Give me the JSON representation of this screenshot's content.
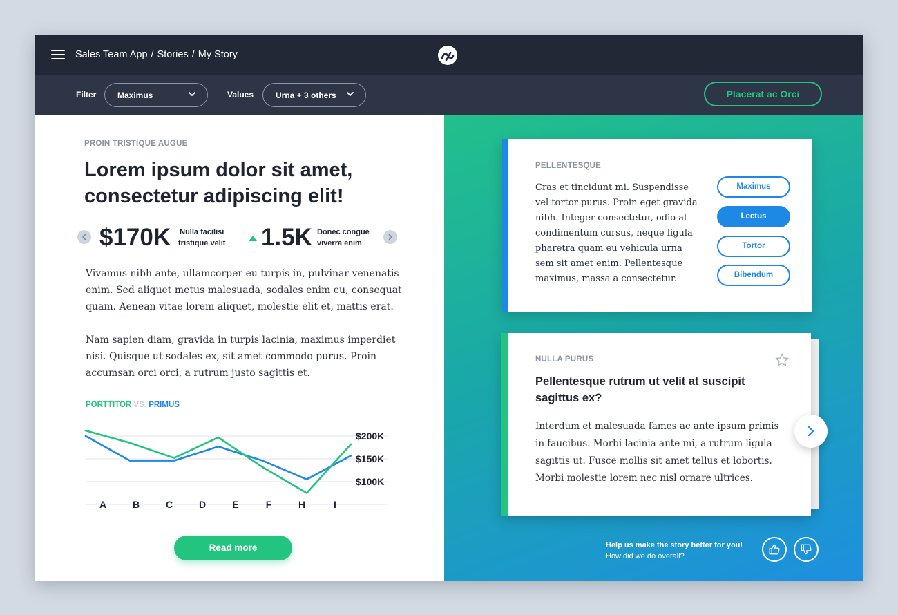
{
  "header": {
    "breadcrumb": [
      "Sales Team App",
      "Stories",
      "My Story"
    ],
    "breadcrumb_sep": "/"
  },
  "filterbar": {
    "filter_label": "Filter",
    "filter_value": "Maximus",
    "values_label": "Values",
    "values_value": "Urna + 3 others",
    "cta_label": "Placerat ac Orci"
  },
  "story": {
    "eyebrow": "PROIN TRISTIQUE AUGUE",
    "headline": "Lorem ipsum dolor sit amet, consectetur adipiscing elit!",
    "kpi1": {
      "value": "$170K",
      "desc_line1": "Nulla facilisi",
      "desc_line2": "tristique velit"
    },
    "kpi2": {
      "value": "1.5K",
      "desc_line1": "Donec congue",
      "desc_line2": "viverra enim",
      "trend": "up"
    },
    "para1": "Vivamus nibh ante, ullamcorper eu turpis in, pulvinar venenatis enim. Sed aliquet metus malesuada, sodales enim eu, consequat quam. Aenean vitae lorem aliquet, molestie elit et, mattis erat.",
    "para2": "Nam sapien diam, gravida in turpis lacinia, maximus imperdiet nisi. Quisque ut sodales ex, sit amet commodo purus. Proin accumsan orci orci, a rutrum justo sagittis et.",
    "legend": {
      "a": "PORTTITOR",
      "vs": "VS.",
      "b": "PRIMUS"
    },
    "read_more": "Read more"
  },
  "chart_data": {
    "type": "line",
    "categories": [
      "A",
      "B",
      "C",
      "D",
      "E",
      "F",
      "H",
      "I"
    ],
    "series": [
      {
        "name": "PORTTITOR",
        "color": "#22c47f",
        "values": [
          212,
          185,
          152,
          197,
          132,
          75,
          182
        ]
      },
      {
        "name": "PRIMUS",
        "color": "#1e88e5",
        "values": [
          200,
          146,
          146,
          177,
          146,
          105,
          157
        ]
      }
    ],
    "series_x": [
      0,
      1,
      2,
      3,
      4,
      5,
      6
    ],
    "y_ticks": [
      200,
      150,
      100
    ],
    "y_tick_labels": [
      "$200K",
      "$150K",
      "$100K"
    ],
    "ylim": [
      50,
      225
    ],
    "grid": true
  },
  "card1": {
    "eyebrow": "PELLENTESQUE",
    "body": "Cras et tincidunt mi. Suspendisse vel tortor purus. Proin eget gravida nibh. Integer consectetur, odio at condimentum cursus, neque ligula pharetra quam eu vehicula urna sem sit amet enim. Pellentesque maximus, massa a consectetur.",
    "options": [
      "Maximus",
      "Lectus",
      "Tortor",
      "Bibendum"
    ],
    "selected": "Lectus"
  },
  "card2": {
    "eyebrow": "NULLA PURUS",
    "title": "Pellentesque rutrum ut velit at suscipit sagittus ex?",
    "body": "Interdum et malesuada fames ac ante ipsum primis in faucibus. Morbi lacinia ante mi, a rutrum ligula sagittis ut. Fusce mollis sit amet tellus et lobortis. Morbi molestie lorem nec nisl ornare ultrices."
  },
  "feedback": {
    "line1": "Help us make the story better for you!",
    "line2": "How did we do overall?"
  },
  "colors": {
    "green": "#22c47f",
    "blue": "#1e88e5",
    "dark": "#222836"
  }
}
